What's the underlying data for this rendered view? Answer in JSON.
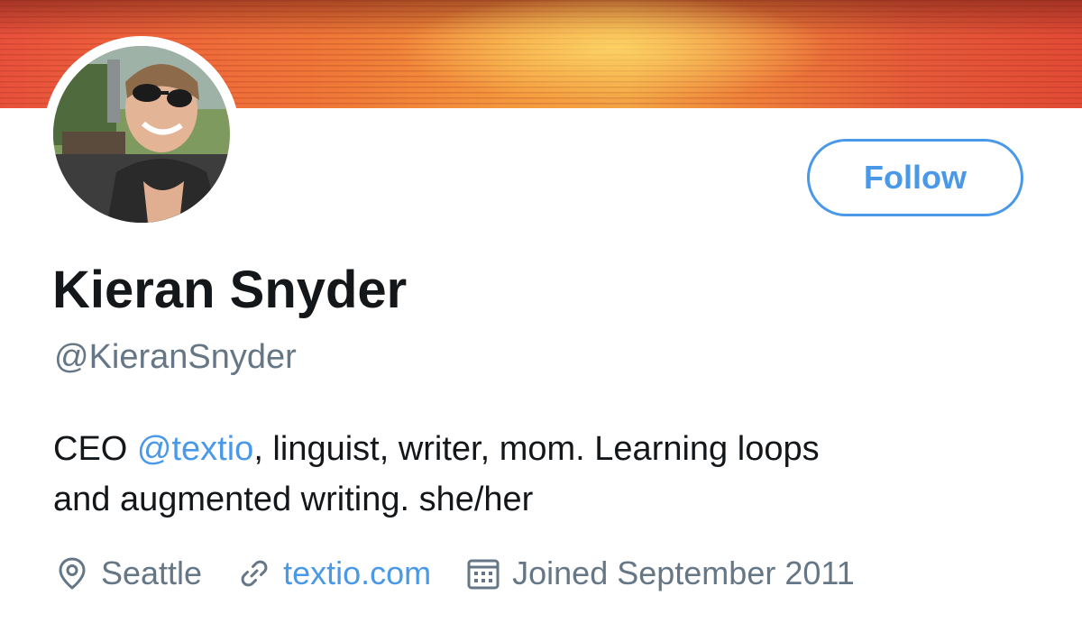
{
  "profile": {
    "display_name": "Kieran Snyder",
    "handle": "@KieranSnyder",
    "follow_label": "Follow",
    "bio": {
      "line1_prefix": "CEO ",
      "mention": "@textio",
      "line1_suffix": ", linguist, writer, mom. Learning loops",
      "line2": "and augmented writing. she/her"
    },
    "location": "Seattle",
    "website": "textio.com",
    "joined": "Joined September 2011"
  },
  "icons": {
    "location": "map-pin-icon",
    "website": "link-icon",
    "joined": "calendar-icon"
  },
  "colors": {
    "accent": "#4a99e9",
    "text_primary": "#14171a",
    "text_secondary": "#657786"
  }
}
